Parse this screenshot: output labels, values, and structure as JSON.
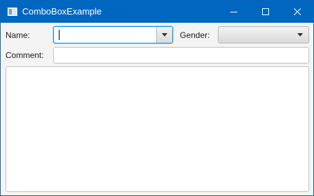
{
  "window": {
    "title": "ComboBoxExample",
    "accent_color": "#0067c0"
  },
  "titlebar": {
    "icons": [
      "app-icon",
      "minimize-icon",
      "maximize-icon",
      "close-icon"
    ]
  },
  "form": {
    "name_label": "Name:",
    "name_value": "",
    "gender_label": "Gender:",
    "gender_selected": "",
    "comment_label": "Comment:",
    "comment_value": "",
    "textarea_value": ""
  }
}
